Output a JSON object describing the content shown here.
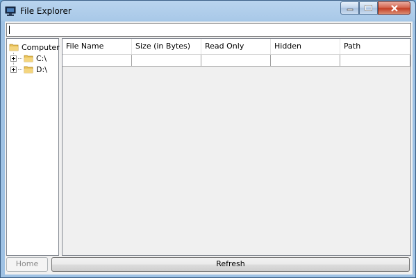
{
  "window": {
    "title": "File Explorer"
  },
  "path_box": {
    "value": ""
  },
  "tree": {
    "root": "Computer",
    "items": [
      {
        "label": "C:\\"
      },
      {
        "label": "D:\\"
      }
    ]
  },
  "table": {
    "columns": [
      "File Name",
      "Size (in Bytes)",
      "Read Only",
      "Hidden",
      "Path"
    ],
    "rows": [
      [
        "",
        "",
        "",
        "",
        ""
      ]
    ]
  },
  "buttons": {
    "home": "Home",
    "refresh": "Refresh"
  },
  "colors": {
    "title_bar": "#a9c9e8",
    "close_button": "#c33b22",
    "client_bg": "#f0f0f0"
  }
}
